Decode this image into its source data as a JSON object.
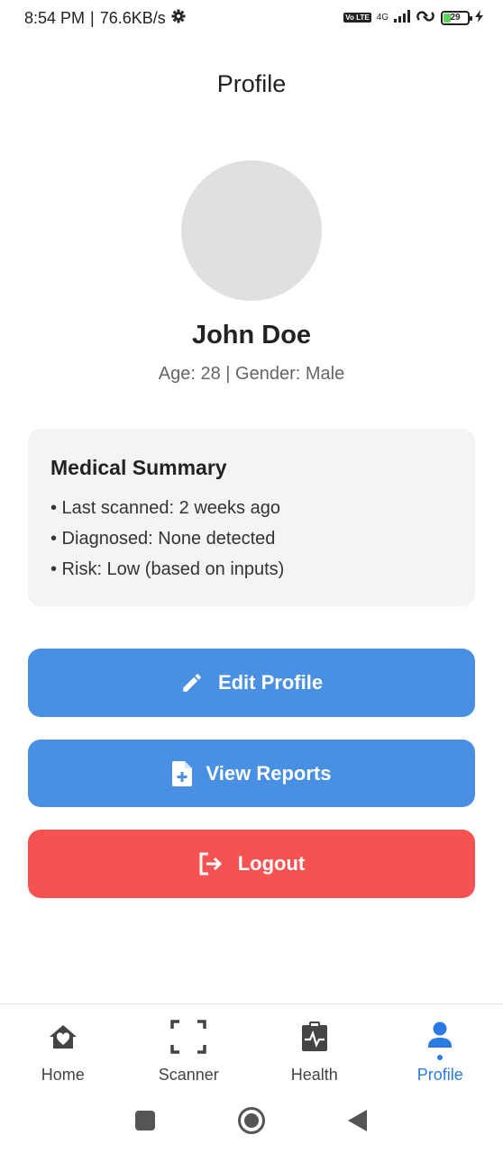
{
  "status_bar": {
    "time": "8:54 PM",
    "speed": "76.6KB/s",
    "volte": "Vo LTE",
    "network": "4G",
    "battery": "29"
  },
  "header": {
    "title": "Profile"
  },
  "profile": {
    "name": "John Doe",
    "meta": "Age: 28 | Gender: Male"
  },
  "summary": {
    "title": "Medical Summary",
    "items": [
      "• Last scanned: 2 weeks ago",
      "• Diagnosed: None detected",
      "• Risk: Low (based on inputs)"
    ]
  },
  "actions": {
    "edit_label": "Edit Profile",
    "reports_label": "View Reports",
    "logout_label": "Logout"
  },
  "bottom_nav": {
    "items": [
      {
        "label": "Home",
        "icon": "home-heart-icon"
      },
      {
        "label": "Scanner",
        "icon": "scan-frame-icon"
      },
      {
        "label": "Health",
        "icon": "clipboard-pulse-icon"
      },
      {
        "label": "Profile",
        "icon": "person-icon",
        "active": true
      }
    ]
  },
  "colors": {
    "primary": "#4a90e2",
    "danger": "#f55252",
    "active_nav": "#2a7be4"
  }
}
